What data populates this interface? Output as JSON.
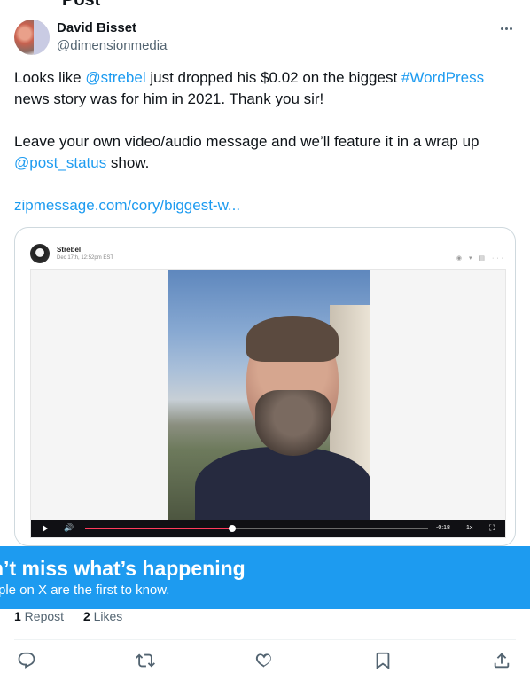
{
  "page": {
    "top_cut_text": "Post"
  },
  "author": {
    "display_name": "David Bisset",
    "handle": "@dimensionmedia"
  },
  "tweet": {
    "segments_line1": [
      "Looks like ",
      "@strebel",
      " just dropped his $0.02 on the biggest ",
      "#WordPress"
    ],
    "line2": "news story was for him in 2021. Thank you sir!",
    "line3": "Leave your own video/audio message and we’ll feature it in a wrap up",
    "mention2": "@post_status",
    "line4_rest": " show.",
    "url": "zipmessage.com/cory/biggest-w..."
  },
  "media": {
    "sender_name": "Strebel",
    "sender_date": "Dec 17th, 12:52pm EST",
    "header_icons": "◉ ▾  ▤  ···",
    "player": {
      "time_remaining": "-0:18",
      "speed": "1x",
      "progress": 0.43
    }
  },
  "banner": {
    "title": "n’t miss what’s happening",
    "subtitle": "ple on X are the first to know."
  },
  "stats": {
    "reposts_count": "1",
    "reposts_label": " Repost",
    "likes_count": "2",
    "likes_label": " Likes"
  },
  "actions": [
    "reply-icon",
    "repost-icon",
    "like-icon",
    "bookmark-icon",
    "share-icon"
  ],
  "colors": {
    "link": "#1d9bf0",
    "banner": "#1d9bf0",
    "secondary_text": "#536471"
  }
}
